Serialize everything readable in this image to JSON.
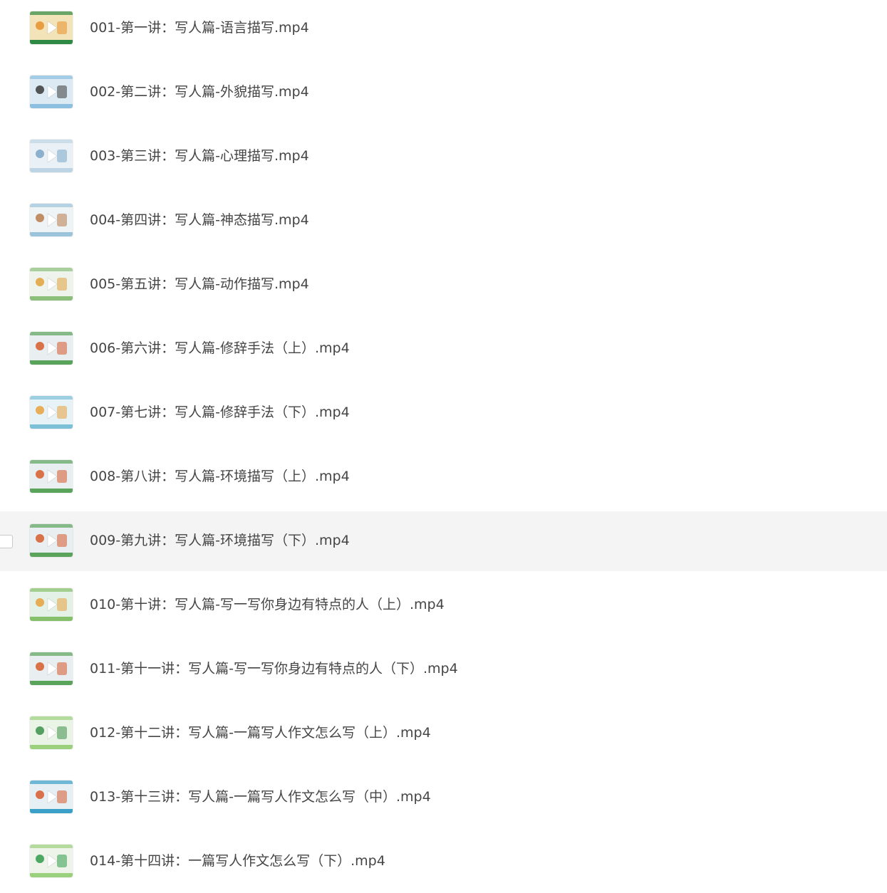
{
  "files": [
    {
      "name": "001-第一讲：写人篇-语言描写.mp4",
      "thumb": {
        "bg": "#f2e3b8",
        "accent": "#e8902c",
        "band": "#2f8a45"
      }
    },
    {
      "name": "002-第二讲：写人篇-外貌描写.mp4",
      "thumb": {
        "bg": "#dcebf3",
        "accent": "#3a3a3a",
        "band": "#8dbfe0"
      }
    },
    {
      "name": "003-第三讲：写人篇-心理描写.mp4",
      "thumb": {
        "bg": "#e9f1f6",
        "accent": "#7aa6c8",
        "band": "#bcd4e3"
      }
    },
    {
      "name": "004-第四讲：写人篇-神态描写.mp4",
      "thumb": {
        "bg": "#eef3f6",
        "accent": "#b87a4a",
        "band": "#9cc3dc"
      }
    },
    {
      "name": "005-第五讲：写人篇-动作描写.mp4",
      "thumb": {
        "bg": "#eef4ec",
        "accent": "#e0a03a",
        "band": "#8cc07a"
      }
    },
    {
      "name": "006-第六讲：写人篇-修辞手法（上）.mp4",
      "thumb": {
        "bg": "#e9eef0",
        "accent": "#d65a2c",
        "band": "#5aa35a"
      }
    },
    {
      "name": "007-第七讲：写人篇-修辞手法（下）.mp4",
      "thumb": {
        "bg": "#e6f2f6",
        "accent": "#e6a13c",
        "band": "#7cc0d8"
      }
    },
    {
      "name": "008-第八讲：写人篇-环境描写（上）.mp4",
      "thumb": {
        "bg": "#e9eef0",
        "accent": "#d65a2c",
        "band": "#5aa35a"
      }
    },
    {
      "name": "009-第九讲：写人篇-环境描写（下）.mp4",
      "thumb": {
        "bg": "#e9eef0",
        "accent": "#d65a2c",
        "band": "#5aa35a"
      }
    },
    {
      "name": "010-第十讲：写人篇-写一写你身边有特点的人（上）.mp4",
      "thumb": {
        "bg": "#e4f1e6",
        "accent": "#e6a13c",
        "band": "#86c06a"
      }
    },
    {
      "name": "011-第十一讲：写人篇-写一写你身边有特点的人（下）.mp4",
      "thumb": {
        "bg": "#e9eef0",
        "accent": "#d65a2c",
        "band": "#5aa35a"
      }
    },
    {
      "name": "012-第十二讲：写人篇-一篇写人作文怎么写（上）.mp4",
      "thumb": {
        "bg": "#eaf4e6",
        "accent": "#3c8f4a",
        "band": "#9bd07c"
      }
    },
    {
      "name": "013-第十三讲：写人篇-一篇写人作文怎么写（中）.mp4",
      "thumb": {
        "bg": "#e6f0f4",
        "accent": "#d65a2c",
        "band": "#3aa0c8"
      }
    },
    {
      "name": "014-第十四讲：一篇写人作文怎么写（下）.mp4",
      "thumb": {
        "bg": "#eef4ea",
        "accent": "#2f9a4a",
        "band": "#9bd07c"
      }
    }
  ],
  "hovered_index": 8,
  "colors": {
    "text": "#454545",
    "hover_bg": "#f4f4f4",
    "play_icon": "#ffffff"
  }
}
